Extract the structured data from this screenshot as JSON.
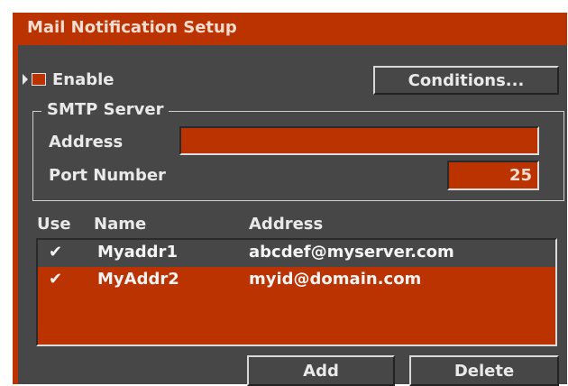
{
  "window": {
    "title": "Mail Notification Setup"
  },
  "enable": {
    "label": "Enable",
    "checked": false
  },
  "conditions_button": {
    "label": "Conditions..."
  },
  "smtp": {
    "group_label": "SMTP Server",
    "address_label": "Address",
    "address_value": "",
    "port_label": "Port Number",
    "port_value": "25"
  },
  "table": {
    "headers": {
      "use": "Use",
      "name": "Name",
      "address": "Address"
    },
    "rows": [
      {
        "use": "✔",
        "name": "Myaddr1",
        "address": "abcdef@myserver.com",
        "selected": false
      },
      {
        "use": "✔",
        "name": "MyAddr2",
        "address": "myid@domain.com",
        "selected": true
      }
    ]
  },
  "buttons": {
    "add": "Add",
    "delete": "Delete"
  },
  "colors": {
    "accent": "#bb3300",
    "panel": "#474747",
    "text": "#e9e9e9",
    "row_unselected": "#474747"
  }
}
